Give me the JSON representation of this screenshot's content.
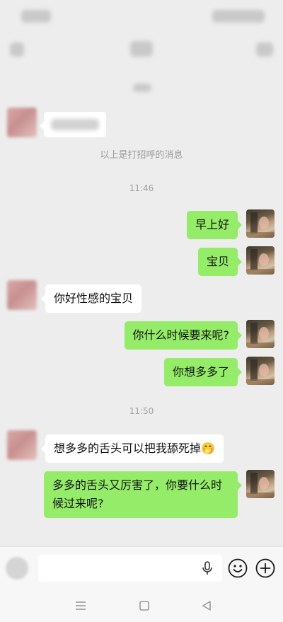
{
  "chat": {
    "greeting_notice": "以上是打招呼的消息",
    "times": [
      "11:46",
      "11:50"
    ],
    "messages": [
      {
        "side": "out",
        "text": "早上好"
      },
      {
        "side": "out",
        "text": "宝贝"
      },
      {
        "side": "in",
        "text": "你好性感的宝贝"
      },
      {
        "side": "out",
        "text": "你什么时候要来呢?"
      },
      {
        "side": "out",
        "text": "你想多多了"
      },
      {
        "side": "in",
        "text": "想多多的舌头可以把我舔死掉🤭"
      },
      {
        "side": "out",
        "text": "多多的舌头又厉害了，你要什么时候过来呢?"
      }
    ]
  },
  "input": {
    "value": "",
    "placeholder": ""
  },
  "icons": {
    "mic": "microphone-icon",
    "emoji": "emoji-icon",
    "plus": "plus-icon",
    "nav_menu": "menu-icon",
    "nav_home": "home-square-icon",
    "nav_back": "back-triangle-icon"
  },
  "colors": {
    "background": "#ededed",
    "outgoing_bubble": "#95ec69",
    "incoming_bubble": "#ffffff",
    "system_text": "#9b9b9b"
  }
}
